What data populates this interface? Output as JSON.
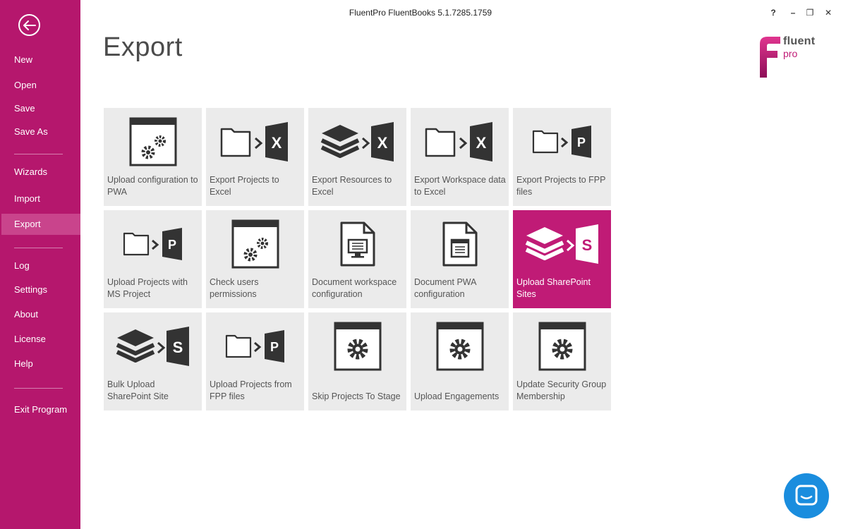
{
  "window": {
    "title": "FluentPro FluentBooks 5.1.7285.1759"
  },
  "window_controls": {
    "help": "?",
    "minimize": "–",
    "restore": "❐",
    "close": "✕"
  },
  "sidebar": {
    "items": [
      {
        "label": "New"
      },
      {
        "label": "Open"
      },
      {
        "label": "Save"
      },
      {
        "label": "Save As"
      },
      {
        "label": "Wizards"
      },
      {
        "label": "Import"
      },
      {
        "label": "Export"
      },
      {
        "label": "Log"
      },
      {
        "label": "Settings"
      },
      {
        "label": "About"
      },
      {
        "label": "License"
      },
      {
        "label": "Help"
      },
      {
        "label": "Exit Program"
      }
    ]
  },
  "page": {
    "title": "Export"
  },
  "logo": {
    "line1": "fluent",
    "line2": "pro"
  },
  "tiles": [
    {
      "label": "Upload configuration to PWA",
      "icon": "window-gears-icon"
    },
    {
      "label": "Export Projects to Excel",
      "icon": "folder-to-excel-icon"
    },
    {
      "label": "Export Resources to Excel",
      "icon": "layers-to-excel-icon"
    },
    {
      "label": "Export Workspace data to Excel",
      "icon": "folder-to-excel-icon"
    },
    {
      "label": "Export Projects to FPP files",
      "icon": "folder-to-project-icon"
    },
    {
      "label": "Upload Projects with MS Project",
      "icon": "folder-to-project-icon"
    },
    {
      "label": "Check users permissions",
      "icon": "window-gears-icon"
    },
    {
      "label": "Document workspace configuration",
      "icon": "document-monitor-icon"
    },
    {
      "label": "Document PWA configuration",
      "icon": "document-window-icon"
    },
    {
      "label": "Upload SharePoint Sites",
      "icon": "layers-to-sharepoint-icon",
      "active": true
    },
    {
      "label": "Bulk Upload SharePoint Site",
      "icon": "layers-to-sharepoint-icon"
    },
    {
      "label": "Upload Projects from FPP files",
      "icon": "folder-to-project-icon"
    },
    {
      "label": "Skip Projects To Stage",
      "icon": "window-gear-icon"
    },
    {
      "label": "Upload Engagements",
      "icon": "window-gear-icon"
    },
    {
      "label": "Update Security Group Membership",
      "icon": "window-gear-icon"
    }
  ],
  "colors": {
    "brand": "#b5176d",
    "active_tile": "#c01b76",
    "tile": "#ebebeb",
    "chat": "#1a8dde"
  }
}
